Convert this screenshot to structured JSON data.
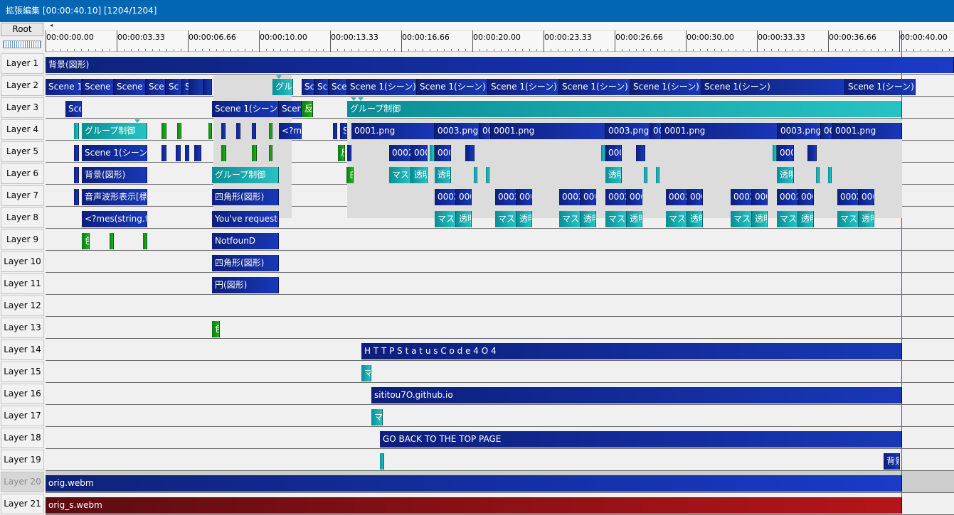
{
  "window": {
    "title": "拡張編集 [00:00:40.10] [1204/1204]"
  },
  "toolbar": {
    "root_label": "Root"
  },
  "ruler": {
    "ticks": [
      "00:00:00.00",
      "00:00:03.33",
      "00:00:06.66",
      "00:00:10.00",
      "00:00:13.33",
      "00:00:16.66",
      "00:00:20.00",
      "00:00:23.33",
      "00:00:26.66",
      "00:00:30.00",
      "00:00:33.33",
      "00:00:36.66",
      "00:00:40.00"
    ]
  },
  "layers": [
    "Layer 1",
    "Layer 2",
    "Layer 3",
    "Layer 4",
    "Layer 5",
    "Layer 6",
    "Layer 7",
    "Layer 8",
    "Layer 9",
    "Layer 10",
    "Layer 11",
    "Layer 12",
    "Layer 13",
    "Layer 14",
    "Layer 15",
    "Layer 16",
    "Layer 17",
    "Layer 18",
    "Layer 19",
    "Layer 20",
    "Layer 21"
  ],
  "disabled_layers": [
    19
  ],
  "colors": {
    "title_bar": "#0166b4",
    "media": "#1838b6",
    "group": "#28c3c4",
    "filter": "#22b11e",
    "audio": "#b3161a",
    "cursor": "#d03030"
  },
  "objects": [
    {
      "layer": 0,
      "type": "lb",
      "label": "背景(図形)"
    },
    {
      "layer": 1,
      "type": "b",
      "label": "Scene 1(シーン)"
    },
    {
      "layer": 1,
      "type": "b",
      "label": "Scene"
    },
    {
      "layer": 1,
      "type": "b",
      "label": "Scene"
    },
    {
      "layer": 1,
      "type": "b",
      "label": "Sce"
    },
    {
      "layer": 1,
      "type": "b",
      "label": "Sc"
    },
    {
      "layer": 1,
      "type": "b",
      "label": "S"
    },
    {
      "layer": 1,
      "type": "b",
      "label": ""
    },
    {
      "layer": 1,
      "type": "b",
      "label": ""
    },
    {
      "layer": 1,
      "type": "t",
      "label": "グループ制御"
    },
    {
      "layer": 1,
      "type": "b",
      "label": "Sc"
    },
    {
      "layer": 1,
      "type": "b",
      "label": "Sce"
    },
    {
      "layer": 1,
      "type": "b",
      "label": "Scen"
    },
    {
      "layer": 1,
      "type": "b",
      "label": "Scene 1(シーン)"
    },
    {
      "layer": 1,
      "type": "b",
      "label": "Scene 1(シーン)"
    },
    {
      "layer": 1,
      "type": "b",
      "label": "Scene 1(シーン)"
    },
    {
      "layer": 1,
      "type": "b",
      "label": "Scene 1(シーン)"
    },
    {
      "layer": 1,
      "type": "b",
      "label": "Scene 1(シーン)"
    },
    {
      "layer": 1,
      "type": "b",
      "label": "Scene 1(シーン)"
    },
    {
      "layer": 1,
      "type": "b",
      "label": "Scene 1(シーン)"
    },
    {
      "layer": 2,
      "type": "b",
      "label": "Scene"
    },
    {
      "layer": 2,
      "type": "b",
      "label": "Scene 1(シーン)"
    },
    {
      "layer": 2,
      "type": "b",
      "label": "Scene"
    },
    {
      "layer": 2,
      "type": "g",
      "label": "反転"
    },
    {
      "layer": 2,
      "type": "t",
      "label": "グループ制御"
    },
    {
      "layer": 3,
      "type": "t",
      "label": ""
    },
    {
      "layer": 3,
      "type": "t",
      "label": "グループ制御"
    },
    {
      "layer": 3,
      "type": "g",
      "label": ""
    },
    {
      "layer": 3,
      "type": "g",
      "label": ""
    },
    {
      "layer": 3,
      "type": "g",
      "label": ""
    },
    {
      "layer": 3,
      "type": "b",
      "label": ""
    },
    {
      "layer": 3,
      "type": "b",
      "label": ""
    },
    {
      "layer": 3,
      "type": "b",
      "label": ""
    },
    {
      "layer": 3,
      "type": "g",
      "label": ""
    },
    {
      "layer": 3,
      "type": "b",
      "label": "<?mes"
    },
    {
      "layer": 3,
      "type": "b",
      "label": ""
    },
    {
      "layer": 3,
      "type": "b",
      "label": "S"
    },
    {
      "layer": 3,
      "type": "b",
      "label": "0001.png"
    },
    {
      "layer": 3,
      "type": "b",
      "label": "0003.png"
    },
    {
      "layer": 3,
      "type": "b",
      "label": "00"
    },
    {
      "layer": 3,
      "type": "b",
      "label": "0001.png"
    },
    {
      "layer": 3,
      "type": "b",
      "label": "0003.png"
    },
    {
      "layer": 3,
      "type": "b",
      "label": "00"
    },
    {
      "layer": 3,
      "type": "b",
      "label": "0001.png"
    },
    {
      "layer": 3,
      "type": "b",
      "label": "0003.png"
    },
    {
      "layer": 3,
      "type": "b",
      "label": "00"
    },
    {
      "layer": 3,
      "type": "b",
      "label": "0001.png"
    },
    {
      "layer": 4,
      "type": "b",
      "label": ""
    },
    {
      "layer": 4,
      "type": "b",
      "label": "Scene 1(シーン)"
    },
    {
      "layer": 4,
      "type": "b",
      "label": ""
    },
    {
      "layer": 4,
      "type": "b",
      "label": ""
    },
    {
      "layer": 4,
      "type": "b",
      "label": ""
    },
    {
      "layer": 4,
      "type": "b",
      "label": ""
    },
    {
      "layer": 4,
      "type": "g",
      "label": ""
    },
    {
      "layer": 4,
      "type": "g",
      "label": ""
    },
    {
      "layer": 4,
      "type": "g",
      "label": ""
    },
    {
      "layer": 4,
      "type": "g",
      "label": "反"
    },
    {
      "layer": 4,
      "type": "b",
      "label": ""
    },
    {
      "layer": 4,
      "type": "b",
      "label": "0002"
    },
    {
      "layer": 4,
      "type": "b",
      "label": "000"
    },
    {
      "layer": 4,
      "type": "t",
      "label": ""
    },
    {
      "layer": 4,
      "type": "b",
      "label": "0004"
    },
    {
      "layer": 4,
      "type": "b",
      "label": ""
    },
    {
      "layer": 4,
      "type": "t",
      "label": ""
    },
    {
      "layer": 4,
      "type": "b",
      "label": "0004"
    },
    {
      "layer": 4,
      "type": "b",
      "label": ""
    },
    {
      "layer": 4,
      "type": "t",
      "label": ""
    },
    {
      "layer": 4,
      "type": "b",
      "label": "0004"
    },
    {
      "layer": 4,
      "type": "b",
      "label": ""
    },
    {
      "layer": 5,
      "type": "b",
      "label": ""
    },
    {
      "layer": 5,
      "type": "b",
      "label": "背景(図形)"
    },
    {
      "layer": 5,
      "type": "t",
      "label": "グループ制御"
    },
    {
      "layer": 5,
      "type": "g",
      "label": "白"
    },
    {
      "layer": 5,
      "type": "t",
      "label": "マスク"
    },
    {
      "layer": 5,
      "type": "t",
      "label": "透明"
    },
    {
      "layer": 5,
      "type": "t",
      "label": "透明"
    },
    {
      "layer": 5,
      "type": "t",
      "label": ""
    },
    {
      "layer": 5,
      "type": "t",
      "label": ""
    },
    {
      "layer": 5,
      "type": "t",
      "label": "透明"
    },
    {
      "layer": 5,
      "type": "t",
      "label": ""
    },
    {
      "layer": 5,
      "type": "t",
      "label": ""
    },
    {
      "layer": 5,
      "type": "t",
      "label": "透明"
    },
    {
      "layer": 5,
      "type": "t",
      "label": ""
    },
    {
      "layer": 5,
      "type": "t",
      "label": ""
    },
    {
      "layer": 6,
      "type": "b",
      "label": ""
    },
    {
      "layer": 6,
      "type": "b",
      "label": "音声波形表示[標準描画]"
    },
    {
      "layer": 6,
      "type": "b",
      "label": "四角形(図形)"
    },
    {
      "layer": 6,
      "type": "b",
      "label": "0002"
    },
    {
      "layer": 6,
      "type": "b",
      "label": "000"
    },
    {
      "layer": 6,
      "type": "b",
      "label": "0002"
    },
    {
      "layer": 6,
      "type": "b",
      "label": "000"
    },
    {
      "layer": 6,
      "type": "b",
      "label": "0002"
    },
    {
      "layer": 6,
      "type": "b",
      "label": "000"
    },
    {
      "layer": 6,
      "type": "b",
      "label": "0002"
    },
    {
      "layer": 6,
      "type": "b",
      "label": "000"
    },
    {
      "layer": 6,
      "type": "b",
      "label": "0002"
    },
    {
      "layer": 6,
      "type": "b",
      "label": "000"
    },
    {
      "layer": 6,
      "type": "b",
      "label": "0002"
    },
    {
      "layer": 6,
      "type": "b",
      "label": "000"
    },
    {
      "layer": 6,
      "type": "b",
      "label": "0002"
    },
    {
      "layer": 6,
      "type": "b",
      "label": "000"
    },
    {
      "layer": 6,
      "type": "b",
      "label": "0002"
    },
    {
      "layer": 6,
      "type": "b",
      "label": "000"
    },
    {
      "layer": 7,
      "type": "b",
      "label": "<?mes(string.format"
    },
    {
      "layer": 7,
      "type": "b",
      "label": "You've requested"
    },
    {
      "layer": 7,
      "type": "t",
      "label": "マスク"
    },
    {
      "layer": 7,
      "type": "t",
      "label": "透明"
    },
    {
      "layer": 7,
      "type": "t",
      "label": "マスク"
    },
    {
      "layer": 7,
      "type": "t",
      "label": "透明"
    },
    {
      "layer": 7,
      "type": "t",
      "label": "マスク"
    },
    {
      "layer": 7,
      "type": "t",
      "label": "透明"
    },
    {
      "layer": 7,
      "type": "t",
      "label": "マスク"
    },
    {
      "layer": 7,
      "type": "t",
      "label": "透明"
    },
    {
      "layer": 7,
      "type": "t",
      "label": "マスク"
    },
    {
      "layer": 7,
      "type": "t",
      "label": "透明"
    },
    {
      "layer": 7,
      "type": "t",
      "label": "マスク"
    },
    {
      "layer": 7,
      "type": "t",
      "label": "透明"
    },
    {
      "layer": 7,
      "type": "t",
      "label": "マスク"
    },
    {
      "layer": 7,
      "type": "t",
      "label": "透明"
    },
    {
      "layer": 7,
      "type": "t",
      "label": "マスク"
    },
    {
      "layer": 7,
      "type": "t",
      "label": "透明"
    },
    {
      "layer": 8,
      "type": "g",
      "label": "色"
    },
    {
      "layer": 8,
      "type": "g",
      "label": ""
    },
    {
      "layer": 8,
      "type": "g",
      "label": ""
    },
    {
      "layer": 8,
      "type": "b",
      "label": "NotfounD"
    },
    {
      "layer": 9,
      "type": "b",
      "label": "四角形(図形)"
    },
    {
      "layer": 10,
      "type": "b",
      "label": "円(図形)"
    },
    {
      "layer": 12,
      "type": "g",
      "label": "色"
    },
    {
      "layer": 13,
      "type": "b",
      "label": "H T T P  S t a t u s  C o d e  4 O 4"
    },
    {
      "layer": 14,
      "type": "t",
      "label": "マ"
    },
    {
      "layer": 15,
      "type": "b",
      "label": "sititou7O.github.io"
    },
    {
      "layer": 16,
      "type": "t",
      "label": "マ"
    },
    {
      "layer": 17,
      "type": "b",
      "label": "GO BACK TO THE TOP PAGE"
    },
    {
      "layer": 18,
      "type": "t",
      "label": ""
    },
    {
      "layer": 18,
      "type": "b",
      "label": "背景"
    },
    {
      "layer": 19,
      "type": "lb",
      "label": "orig.webm"
    },
    {
      "layer": 20,
      "type": "r",
      "label": "orig_s.webm"
    }
  ]
}
